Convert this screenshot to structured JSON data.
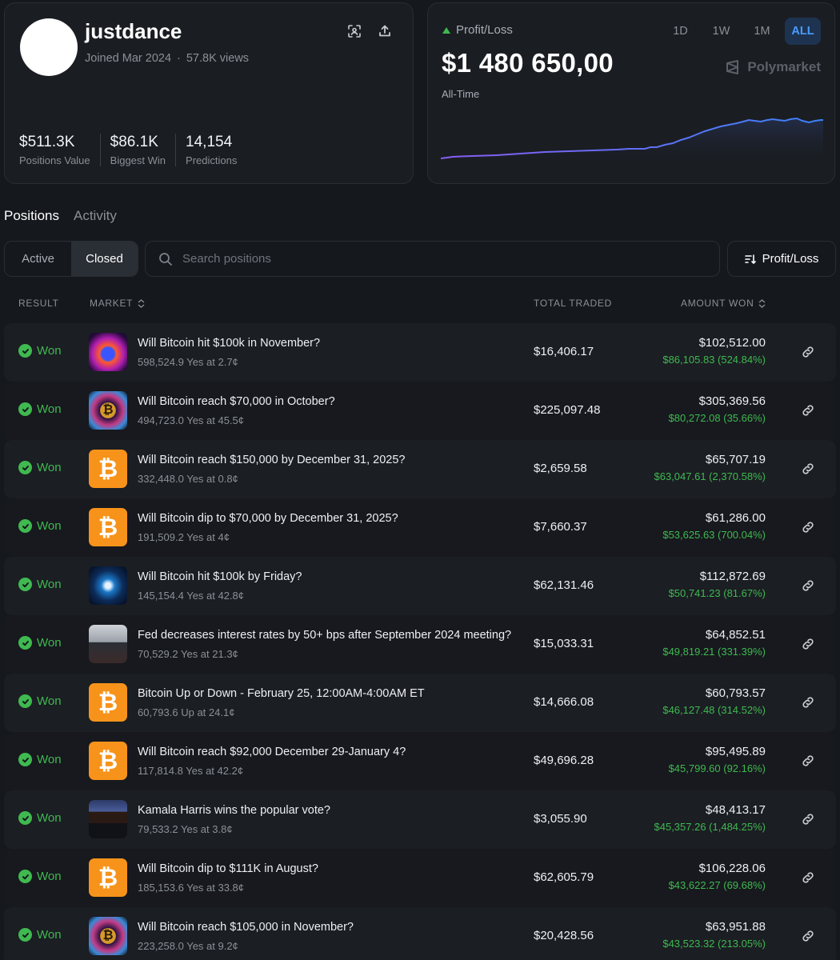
{
  "profile": {
    "username": "justdance",
    "joined": "Joined Mar 2024",
    "views": "57.8K views",
    "stats": [
      {
        "value": "$511.3K",
        "label": "Positions Value"
      },
      {
        "value": "$86.1K",
        "label": "Biggest Win"
      },
      {
        "value": "14,154",
        "label": "Predictions"
      }
    ]
  },
  "pnl": {
    "label": "Profit/Loss",
    "value": "$1 480 650,00",
    "period": "All-Time",
    "timeframes": [
      "1D",
      "1W",
      "1M",
      "ALL"
    ],
    "active_timeframe": "ALL",
    "brand": "Polymarket",
    "colors": {
      "start": "#8b5cf6",
      "end": "#3b82f6"
    }
  },
  "tabs": {
    "positions": "Positions",
    "activity": "Activity",
    "active": "Positions"
  },
  "filter": {
    "active_label": "Active",
    "closed_label": "Closed",
    "selected": "Closed"
  },
  "search": {
    "placeholder": "Search positions"
  },
  "sort": {
    "label": "Profit/Loss"
  },
  "table": {
    "headers": {
      "result": "RESULT",
      "market": "MARKET",
      "traded": "TOTAL TRADED",
      "won": "AMOUNT WON"
    },
    "rows": [
      {
        "result": "Won",
        "icon": "fire",
        "title": "Will Bitcoin hit $100k in November?",
        "sub": "598,524.9 Yes at 2.7¢",
        "traded": "$16,406.17",
        "won": "$102,512.00",
        "gain": "$86,105.83 (524.84%)"
      },
      {
        "result": "Won",
        "icon": "coin",
        "title": "Will Bitcoin reach $70,000 in October?",
        "sub": "494,723.0 Yes at 45.5¢",
        "traded": "$225,097.48",
        "won": "$305,369.56",
        "gain": "$80,272.08 (35.66%)"
      },
      {
        "result": "Won",
        "icon": "btc",
        "title": "Will Bitcoin reach $150,000 by December 31, 2025?",
        "sub": "332,448.0 Yes at 0.8¢",
        "traded": "$2,659.58",
        "won": "$65,707.19",
        "gain": "$63,047.61 (2,370.58%)"
      },
      {
        "result": "Won",
        "icon": "btc",
        "title": "Will Bitcoin dip to $70,000 by December 31, 2025?",
        "sub": "191,509.2 Yes at 4¢",
        "traded": "$7,660.37",
        "won": "$61,286.00",
        "gain": "$53,625.63 (700.04%)"
      },
      {
        "result": "Won",
        "icon": "tech",
        "title": "Will Bitcoin hit $100k by Friday?",
        "sub": "145,154.4 Yes at 42.8¢",
        "traded": "$62,131.46",
        "won": "$112,872.69",
        "gain": "$50,741.23 (81.67%)"
      },
      {
        "result": "Won",
        "icon": "person",
        "title": "Fed decreases interest rates by 50+ bps after September 2024 meeting?",
        "sub": "70,529.2 Yes at 21.3¢",
        "traded": "$15,033.31",
        "won": "$64,852.51",
        "gain": "$49,819.21 (331.39%)"
      },
      {
        "result": "Won",
        "icon": "btc",
        "title": "Bitcoin Up or Down - February 25, 12:00AM-4:00AM ET",
        "sub": "60,793.6 Up at 24.1¢",
        "traded": "$14,666.08",
        "won": "$60,793.57",
        "gain": "$46,127.48 (314.52%)"
      },
      {
        "result": "Won",
        "icon": "btc",
        "title": "Will Bitcoin reach $92,000 December 29-January 4?",
        "sub": "117,814.8 Yes at 42.2¢",
        "traded": "$49,696.28",
        "won": "$95,495.89",
        "gain": "$45,799.60 (92.16%)"
      },
      {
        "result": "Won",
        "icon": "kamala",
        "title": "Kamala Harris wins the popular vote?",
        "sub": "79,533.2 Yes at 3.8¢",
        "traded": "$3,055.90",
        "won": "$48,413.17",
        "gain": "$45,357.26 (1,484.25%)"
      },
      {
        "result": "Won",
        "icon": "btc",
        "title": "Will Bitcoin dip to $111K in August?",
        "sub": "185,153.6 Yes at 33.8¢",
        "traded": "$62,605.79",
        "won": "$106,228.06",
        "gain": "$43,622.27 (69.68%)"
      },
      {
        "result": "Won",
        "icon": "coin",
        "title": "Will Bitcoin reach $105,000 in November?",
        "sub": "223,258.0 Yes at 9.2¢",
        "traded": "$20,428.56",
        "won": "$63,951.88",
        "gain": "$43,523.32 (213.05%)"
      }
    ]
  }
}
